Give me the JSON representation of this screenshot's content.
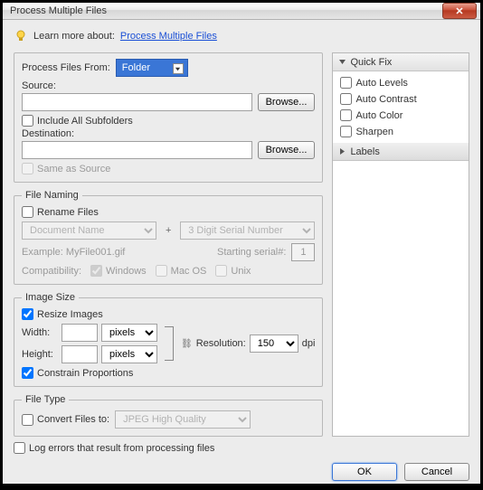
{
  "window": {
    "title": "Process Multiple Files"
  },
  "learn": {
    "label": "Learn more about:",
    "link": "Process Multiple Files"
  },
  "processFrom": {
    "label": "Process Files From:",
    "value": "Folder"
  },
  "source": {
    "label": "Source:",
    "browse": "Browse..."
  },
  "includeSub": {
    "label": "Include All Subfolders"
  },
  "destination": {
    "label": "Destination:",
    "browse": "Browse..."
  },
  "sameSource": {
    "label": "Same as Source"
  },
  "fileNaming": {
    "legend": "File Naming",
    "rename": "Rename Files",
    "part1": "Document Name",
    "plus": "+",
    "part2": "3 Digit Serial Number",
    "example": "Example: MyFile001.gif",
    "startingLabel": "Starting serial#:",
    "startingValue": "1",
    "compatLabel": "Compatibility:",
    "win": "Windows",
    "mac": "Mac OS",
    "unix": "Unix"
  },
  "imageSize": {
    "legend": "Image Size",
    "resize": "Resize Images",
    "widthLabel": "Width:",
    "heightLabel": "Height:",
    "unit": "pixels",
    "resLabel": "Resolution:",
    "resValue": "150",
    "resUnit": "dpi",
    "constrain": "Constrain Proportions"
  },
  "fileType": {
    "legend": "File Type",
    "convert": "Convert Files to:",
    "value": "JPEG High Quality"
  },
  "logErrors": "Log errors that result from processing files",
  "quickFix": {
    "title": "Quick Fix",
    "autoLevels": "Auto Levels",
    "autoContrast": "Auto Contrast",
    "autoColor": "Auto Color",
    "sharpen": "Sharpen"
  },
  "labels": {
    "title": "Labels"
  },
  "buttons": {
    "ok": "OK",
    "cancel": "Cancel"
  }
}
